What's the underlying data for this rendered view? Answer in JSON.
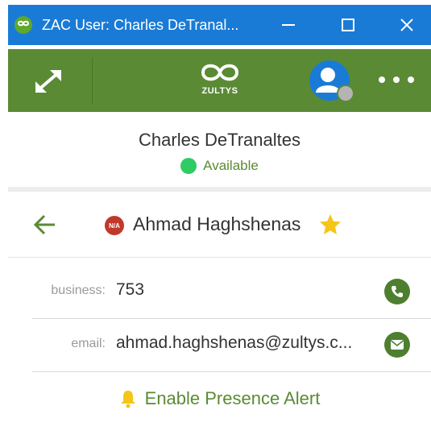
{
  "window": {
    "title": "ZAC User: Charles DeTranal...",
    "app_icon_text": "ZAC",
    "minimize_glyph": "—",
    "close_glyph": "✕"
  },
  "toolbar": {
    "logo_text": "ZULTYS",
    "accent_color": "#5b8a35"
  },
  "user": {
    "name": "Charles DeTranaltes",
    "status": "Available",
    "status_color": "#2ecc62"
  },
  "contact": {
    "name": "Ahmad Haghshenas",
    "presence_badge": "N/A",
    "favorite": true,
    "fields": [
      {
        "label": "business:",
        "value": "753",
        "action_icon": "phone-icon"
      },
      {
        "label": "email:",
        "value": "ahmad.haghshenas@zultys.c...",
        "action_icon": "mail-icon"
      }
    ]
  },
  "alert": {
    "label": "Enable Presence Alert"
  }
}
